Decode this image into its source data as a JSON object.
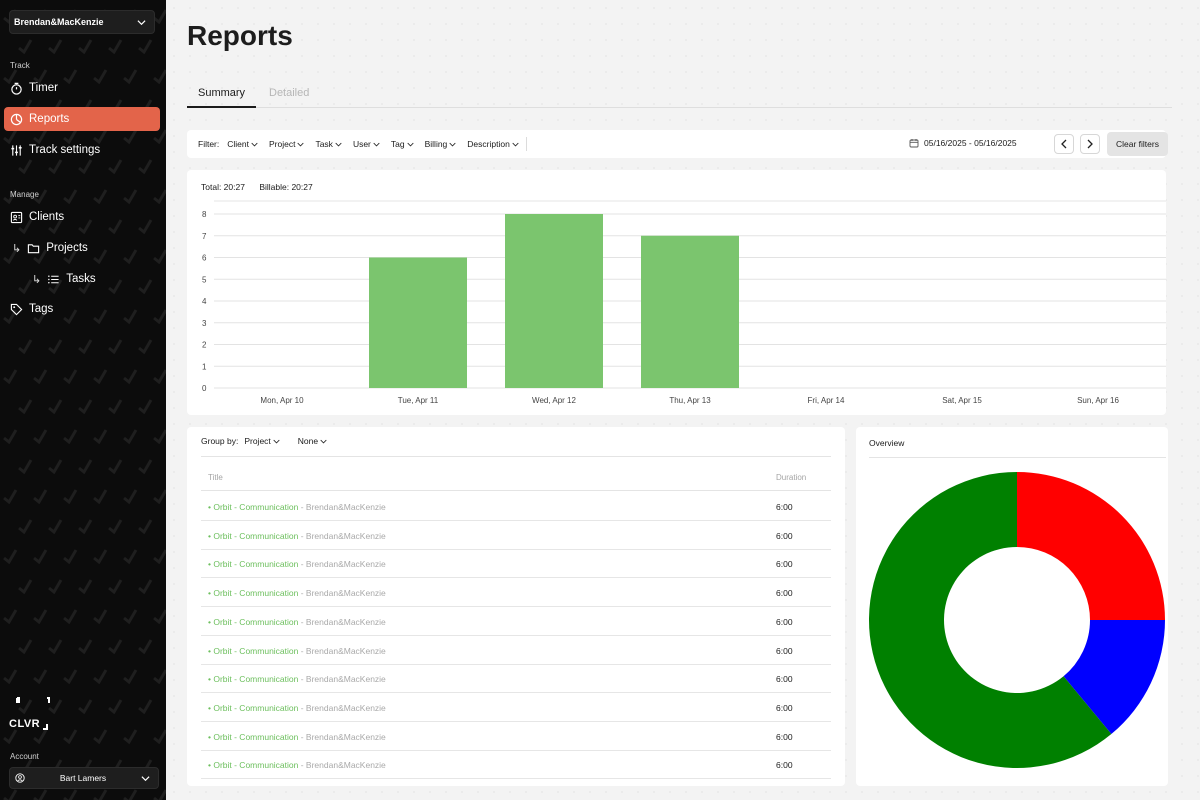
{
  "sidebar": {
    "workspace": "Brendan&MacKenzie",
    "track_label": "Track",
    "manage_label": "Manage",
    "track_items": [
      {
        "label": "Timer",
        "icon": "stopwatch-icon"
      },
      {
        "label": "Reports",
        "icon": "pie-chart-icon",
        "active": true
      },
      {
        "label": "Track settings",
        "icon": "sliders-icon"
      }
    ],
    "manage_items": [
      {
        "label": "Clients",
        "icon": "contact-card-icon"
      },
      {
        "label": "Projects",
        "icon": "folder-icon"
      },
      {
        "label": "Tasks",
        "icon": "list-icon"
      },
      {
        "label": "Tags",
        "icon": "tag-icon"
      }
    ],
    "logo_text": "CLVR",
    "account_label": "Account",
    "account_name": "Bart Lamers",
    "accent_color": "#e3644a"
  },
  "page": {
    "title": "Reports",
    "tabs": [
      {
        "label": "Summary",
        "active": true
      },
      {
        "label": "Detailed",
        "active": false
      }
    ]
  },
  "filters": {
    "label": "Filter:",
    "items": [
      "Client",
      "Project",
      "Task",
      "User",
      "Tag",
      "Billing",
      "Description"
    ],
    "date_range": "05/16/2025 - 05/16/2025",
    "clear_label": "Clear filters"
  },
  "totals": {
    "total": "Total: 20:27",
    "billable": "Billable: 20:27"
  },
  "chart_data": {
    "type": "bar",
    "categories": [
      "Mon, Apr 10",
      "Tue, Apr 11",
      "Wed, Apr 12",
      "Thu, Apr 13",
      "Fri, Apr 14",
      "Sat, Apr 15",
      "Sun, Apr 16"
    ],
    "values": [
      0,
      6,
      8,
      7,
      0,
      0,
      0
    ],
    "ylim": [
      0,
      8
    ],
    "yticks": [
      0,
      1,
      2,
      3,
      4,
      5,
      6,
      7,
      8
    ],
    "bar_color": "#7bc56e",
    "grid": true
  },
  "table": {
    "group_by_label": "Group by:",
    "group_by_primary": "Project",
    "group_by_secondary": "None",
    "columns": {
      "title": "Title",
      "duration": "Duration"
    },
    "rows": [
      {
        "project": "• Orbit - Communication",
        "client": " - Brendan&MacKenzie",
        "duration": "6:00"
      },
      {
        "project": "• Orbit - Communication",
        "client": " - Brendan&MacKenzie",
        "duration": "6:00"
      },
      {
        "project": "• Orbit - Communication",
        "client": " - Brendan&MacKenzie",
        "duration": "6:00"
      },
      {
        "project": "• Orbit - Communication",
        "client": " - Brendan&MacKenzie",
        "duration": "6:00"
      },
      {
        "project": "• Orbit - Communication",
        "client": " - Brendan&MacKenzie",
        "duration": "6:00"
      },
      {
        "project": "• Orbit - Communication",
        "client": " - Brendan&MacKenzie",
        "duration": "6:00"
      },
      {
        "project": "• Orbit - Communication",
        "client": " - Brendan&MacKenzie",
        "duration": "6:00"
      },
      {
        "project": "• Orbit - Communication",
        "client": " - Brendan&MacKenzie",
        "duration": "6:00"
      },
      {
        "project": "• Orbit - Communication",
        "client": " - Brendan&MacKenzie",
        "duration": "6:00"
      },
      {
        "project": "• Orbit - Communication",
        "client": " - Brendan&MacKenzie",
        "duration": "6:00"
      }
    ]
  },
  "overview": {
    "title": "Overview",
    "donut": {
      "type": "pie",
      "hole": true,
      "slices": [
        {
          "value": 25,
          "color": "#ff0000"
        },
        {
          "value": 14,
          "color": "#0000ff"
        },
        {
          "value": 61,
          "color": "#008000"
        }
      ]
    }
  }
}
